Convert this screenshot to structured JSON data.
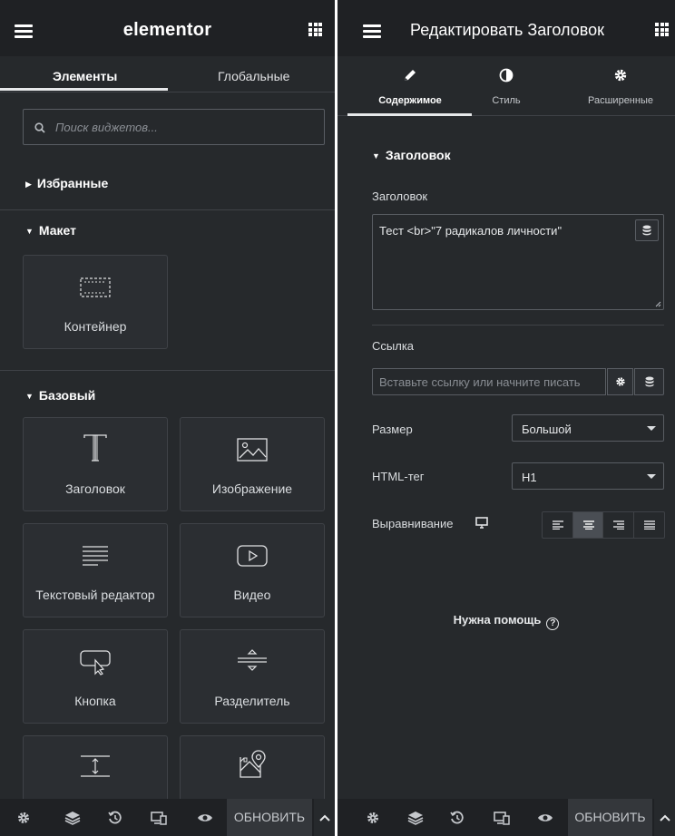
{
  "left": {
    "header": {
      "logo": "elementor"
    },
    "tabs": [
      {
        "label": "Элементы",
        "active": true
      },
      {
        "label": "Глобальные",
        "active": false
      }
    ],
    "search": {
      "placeholder": "Поиск виджетов..."
    },
    "sections": [
      {
        "label": "Избранные",
        "expanded": false
      },
      {
        "label": "Макет",
        "expanded": true,
        "widgets": [
          {
            "label": "Контейнер",
            "icon": "container-icon"
          }
        ]
      },
      {
        "label": "Базовый",
        "expanded": true,
        "widgets": [
          {
            "label": "Заголовок",
            "icon": "heading-icon"
          },
          {
            "label": "Изображение",
            "icon": "image-icon"
          },
          {
            "label": "Текстовый редактор",
            "icon": "text-editor-icon"
          },
          {
            "label": "Видео",
            "icon": "video-icon"
          },
          {
            "label": "Кнопка",
            "icon": "button-icon"
          },
          {
            "label": "Разделитель",
            "icon": "divider-icon"
          },
          {
            "label": "",
            "icon": "spacer-icon"
          },
          {
            "label": "",
            "icon": "google-maps-icon"
          }
        ]
      }
    ],
    "footer": {
      "update_label": "ОБНОВИТЬ"
    }
  },
  "right": {
    "header": {
      "title": "Редактировать Заголовок"
    },
    "tabs": [
      {
        "label": "Содержимое",
        "icon": "pencil-icon",
        "active": true
      },
      {
        "label": "Стиль",
        "icon": "contrast-icon",
        "active": false
      },
      {
        "label": "Расширенные",
        "icon": "gear-icon",
        "active": false
      }
    ],
    "section_title": "Заголовок",
    "title_field": {
      "label": "Заголовок",
      "value": "Тест <br>\"7 радикалов личности\""
    },
    "link_field": {
      "label": "Ссылка",
      "placeholder": "Вставьте ссылку или начните писать"
    },
    "size_field": {
      "label": "Размер",
      "value": "Большой"
    },
    "html_tag_field": {
      "label": "HTML-тег",
      "value": "H1"
    },
    "alignment_field": {
      "label": "Выравнивание",
      "selected": "center"
    },
    "help": {
      "label": "Нужна помощь"
    },
    "footer": {
      "update_label": "ОБНОВИТЬ"
    }
  }
}
